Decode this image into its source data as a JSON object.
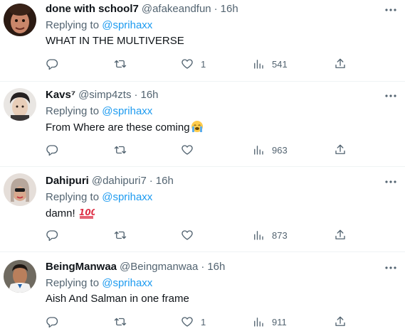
{
  "replies": [
    {
      "name": "done with school7",
      "handle": "@afakeandfun",
      "sep": "·",
      "time": "16h",
      "replying_prefix": "Replying to ",
      "replying_to": "@sprihaxx",
      "text": "WHAT IN THE MULTIVERSE",
      "emoji": "",
      "reply_count": "",
      "retweet_count": "",
      "like_count": "1",
      "view_count": "541"
    },
    {
      "name": "Kavs⁷",
      "handle": "@simp4zts",
      "sep": "·",
      "time": "16h",
      "replying_prefix": "Replying to ",
      "replying_to": "@sprihaxx",
      "text": "From Where are these coming",
      "emoji": "loudly-crying-face",
      "reply_count": "",
      "retweet_count": "",
      "like_count": "",
      "view_count": "963"
    },
    {
      "name": "Dahipuri",
      "handle": "@dahipuri7",
      "sep": "·",
      "time": "16h",
      "replying_prefix": "Replying to ",
      "replying_to": "@sprihaxx",
      "text": "damn!",
      "emoji": "hundred-points",
      "reply_count": "",
      "retweet_count": "",
      "like_count": "",
      "view_count": "873"
    },
    {
      "name": "BeingManwaa",
      "handle": "@Beingmanwaa",
      "sep": "·",
      "time": "16h",
      "replying_prefix": "Replying to ",
      "replying_to": "@sprihaxx",
      "text": "Aish And Salman in one frame",
      "emoji": "",
      "reply_count": "",
      "retweet_count": "",
      "like_count": "1",
      "view_count": "911"
    }
  ],
  "icons": {
    "more": "more-horizontal-icon",
    "reply": "reply-icon",
    "retweet": "retweet-icon",
    "like": "like-heart-icon",
    "views": "views-chart-icon",
    "share": "share-icon"
  },
  "colors": {
    "text": "#0f1419",
    "secondary": "#536471",
    "link": "#1d9bf0",
    "divider": "#eff3f4"
  }
}
